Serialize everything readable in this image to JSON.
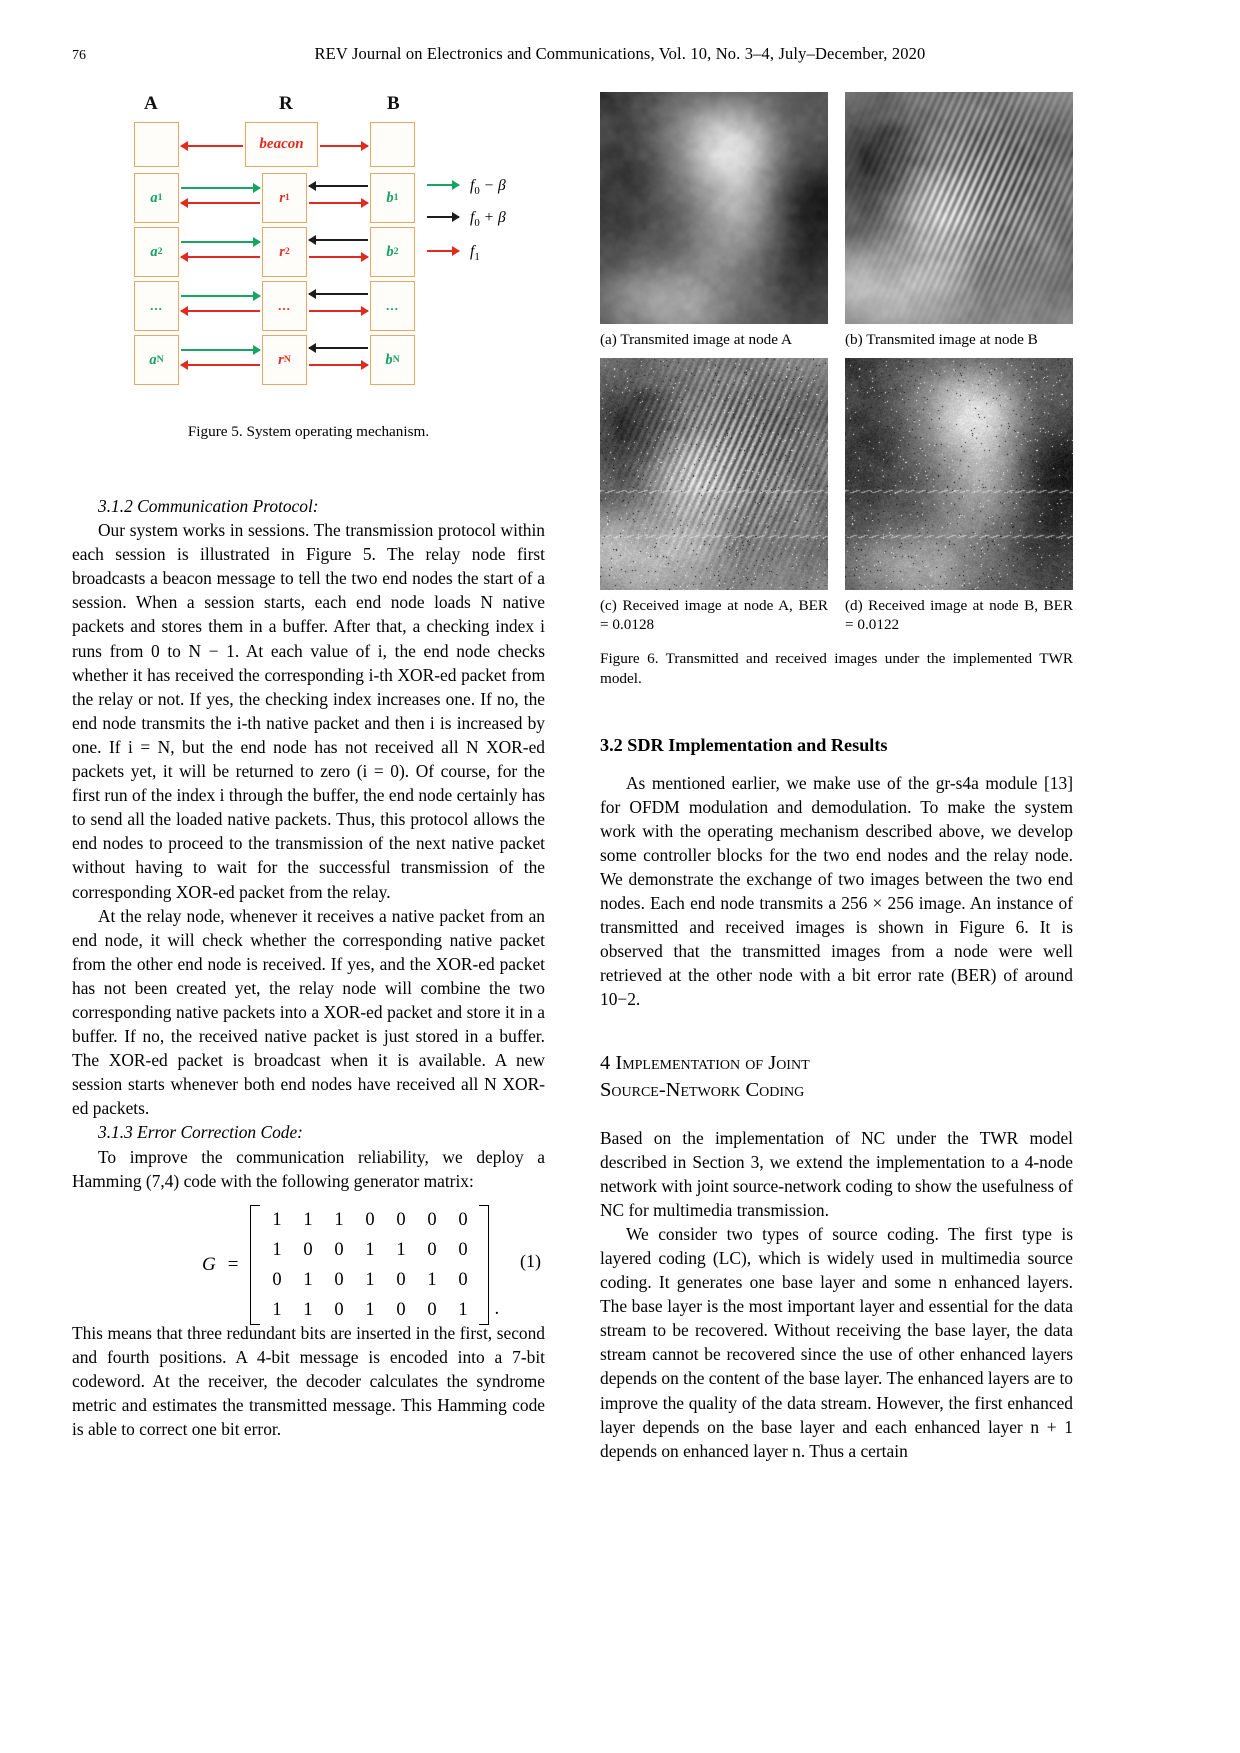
{
  "runhead": {
    "folio": "76",
    "journal": "REV Journal on Electronics and Communications, Vol. 10, No. 3–4, July–December, 2020"
  },
  "figure5": {
    "column_labels": {
      "a": "A",
      "r": "R",
      "b": "B"
    },
    "beacon_label": "beacon",
    "rows": [
      {
        "a": "",
        "r": "beacon",
        "b": ""
      },
      {
        "a": "a",
        "a_sub": "1",
        "r": "r",
        "r_sub": "1",
        "b": "b",
        "b_sub": "1"
      },
      {
        "a": "a",
        "a_sub": "2",
        "r": "r",
        "r_sub": "2",
        "b": "b",
        "b_sub": "2"
      },
      {
        "a": "...",
        "r": "...",
        "b": "..."
      },
      {
        "a": "a",
        "a_sub": "N",
        "r": "r",
        "r_sub": "N",
        "b": "b",
        "b_sub": "N"
      }
    ],
    "legend": [
      {
        "color": "#18a564",
        "text": "f",
        "sub": "0",
        "rest": " − β"
      },
      {
        "color": "#1c1c1c",
        "text": "f",
        "sub": "0",
        "rest": " + β"
      },
      {
        "color": "#e02b20",
        "text": "f",
        "sub": "1",
        "rest": ""
      }
    ],
    "caption": "Figure 5. System operating mechanism."
  },
  "left_column": {
    "subhead_312": "3.1.2 Communication Protocol:",
    "para_1": "Our system works in sessions. The transmission protocol within each session is illustrated in Figure 5. The relay node first broadcasts a beacon message to tell the two end nodes the start of a session. When a session starts, each end node loads N native packets and stores them in a buffer. After that, a checking index i runs from 0 to N − 1. At each value of i, the end node checks whether it has received the corresponding i-th XOR-ed packet from the relay or not. If yes, the checking index increases one. If no, the end node transmits the i-th native packet and then i is increased by one. If i = N, but the end node has not received all N XOR-ed packets yet, it will be returned to zero (i = 0). Of course, for the first run of the index i through the buffer, the end node certainly has to send all the loaded native packets. Thus, this protocol allows the end nodes to proceed to the transmission of the next native packet without having to wait for the successful transmission of the corresponding XOR-ed packet from the relay.",
    "para_2": "At the relay node, whenever it receives a native packet from an end node, it will check whether the corresponding native packet from the other end node is received. If yes, and the XOR-ed packet has not been created yet, the relay node will combine the two corresponding native packets into a XOR-ed packet and store it in a buffer. If no, the received native packet is just stored in a buffer. The XOR-ed packet is broadcast when it is available. A new session starts whenever both end nodes have received all N XOR-ed packets.",
    "subhead_313": "3.1.3 Error Correction Code:",
    "para_3": "To improve the communication reliability, we deploy a Hamming (7,4) code with the following generator matrix:",
    "equation": {
      "lhs": "G",
      "equals": "=",
      "matrix": [
        [
          1,
          1,
          1,
          0,
          0,
          0,
          0
        ],
        [
          1,
          0,
          0,
          1,
          1,
          0,
          0
        ],
        [
          0,
          1,
          0,
          1,
          0,
          1,
          0
        ],
        [
          1,
          1,
          0,
          1,
          0,
          0,
          1
        ]
      ],
      "trailing_punct": ".",
      "number": "(1)"
    },
    "para_4": "This means that three redundant bits are inserted in the first, second and fourth positions. A 4-bit message is encoded into a 7-bit codeword. At the receiver, the decoder calculates the syndrome metric and estimates the transmitted message. This Hamming code is able to correct one bit error."
  },
  "figure6": {
    "subcaptions": [
      "(a) Transmited image at node A",
      "(b) Transmited image at node B",
      "(c) Received image at node A, BER = 0.0128",
      "(d) Received image at node B, BER = 0.0122"
    ],
    "caption": "Figure 6. Transmitted and received images under the implemented TWR model."
  },
  "right_column": {
    "sec_32_head": "3.2 SDR Implementation and Results",
    "para_1": "As mentioned earlier, we make use of the gr-s4a module [13] for OFDM modulation and demodulation. To make the system work with the operating mechanism described above, we develop some controller blocks for the two end nodes and the relay node. We demonstrate the exchange of two images between the two end nodes. Each end node transmits a 256 × 256 image. An instance of transmitted and received images is shown in Figure 6. It is observed that the transmitted images from a node were well retrieved at the other node with a bit error rate (BER) of around 10−2.",
    "sec_4_head_line1": "4 Implementation of Joint",
    "sec_4_head_line2": "Source-Network Coding",
    "para_2": "Based on the implementation of NC under the TWR model described in Section 3, we extend the implementation to a 4-node network with joint source-network coding to show the usefulness of NC for multimedia transmission.",
    "para_3": "We consider two types of source coding. The first type is layered coding (LC), which is widely used in multimedia source coding. It generates one base layer and some n enhanced layers. The base layer is the most important layer and essential for the data stream to be recovered. Without receiving the base layer, the data stream cannot be recovered since the use of other enhanced layers depends on the content of the base layer. The enhanced layers are to improve the quality of the data stream. However, the first enhanced layer depends on the base layer and each enhanced layer n + 1 depends on enhanced layer n. Thus a certain"
  }
}
